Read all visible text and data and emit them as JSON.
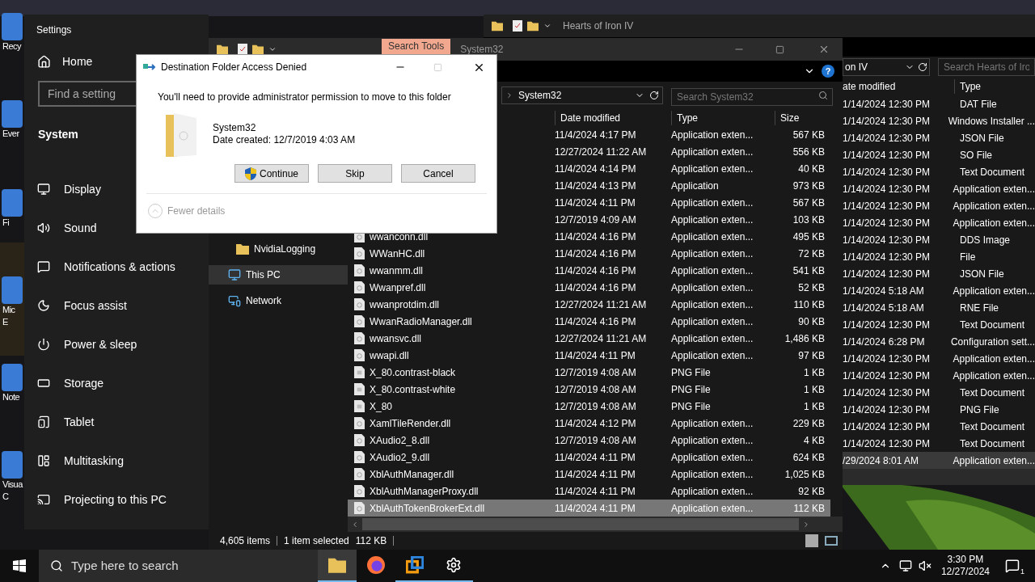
{
  "desktop_icons": [
    {
      "lines": [
        "Recy"
      ]
    },
    {
      "lines": [
        "Ever"
      ]
    },
    {
      "lines": [
        "Fi"
      ]
    },
    {
      "lines": [
        "Mic",
        "E"
      ]
    },
    {
      "lines": [
        "Note"
      ]
    },
    {
      "lines": [
        "Visua",
        "C"
      ]
    }
  ],
  "settings": {
    "title": "Settings",
    "home": "Home",
    "search_placeholder": "Find a setting",
    "section": "System",
    "items": [
      "Display",
      "Sound",
      "Notifications & actions",
      "Focus assist",
      "Power & sleep",
      "Storage",
      "Tablet",
      "Multitasking",
      "Projecting to this PC"
    ]
  },
  "hoi_window": {
    "title": "Hearts of Iron IV",
    "address": "on IV",
    "search_placeholder": "Search Hearts of Iro",
    "columns": [
      "ate modified",
      "Type"
    ],
    "rows": [
      {
        "date": "1/14/2024 12:30 PM",
        "type": "DAT File",
        "selected": false
      },
      {
        "date": "1/14/2024 12:30 PM",
        "type": "Windows Installer ...",
        "selected": false
      },
      {
        "date": "1/14/2024 12:30 PM",
        "type": "JSON File",
        "selected": false
      },
      {
        "date": "1/14/2024 12:30 PM",
        "type": "SO File",
        "selected": false
      },
      {
        "date": "1/14/2024 12:30 PM",
        "type": "Text Document",
        "selected": false
      },
      {
        "date": "1/14/2024 12:30 PM",
        "type": "Application exten...",
        "selected": false
      },
      {
        "date": "1/14/2024 12:30 PM",
        "type": "Application exten...",
        "selected": false
      },
      {
        "date": "1/14/2024 12:30 PM",
        "type": "Application exten...",
        "selected": false
      },
      {
        "date": "1/14/2024 12:30 PM",
        "type": "DDS Image",
        "selected": false
      },
      {
        "date": "1/14/2024 12:30 PM",
        "type": "File",
        "selected": false
      },
      {
        "date": "1/14/2024 12:30 PM",
        "type": "JSON File",
        "selected": false
      },
      {
        "date": "1/14/2024 5:18 AM",
        "type": "Application exten...",
        "selected": false
      },
      {
        "date": "1/14/2024 5:18 AM",
        "type": "RNE File",
        "selected": false
      },
      {
        "date": "1/14/2024 12:30 PM",
        "type": "Text Document",
        "selected": false
      },
      {
        "date": "1/14/2024 6:28 PM",
        "type": "Configuration sett...",
        "selected": false
      },
      {
        "date": "1/14/2024 12:30 PM",
        "type": "Application exten...",
        "selected": false
      },
      {
        "date": "1/14/2024 12:30 PM",
        "type": "Application exten...",
        "selected": false
      },
      {
        "date": "1/14/2024 12:30 PM",
        "type": "Text Document",
        "selected": false
      },
      {
        "date": "1/14/2024 12:30 PM",
        "type": "PNG File",
        "selected": false
      },
      {
        "date": "1/14/2024 12:30 PM",
        "type": "Text Document",
        "selected": false
      },
      {
        "date": "1/14/2024 12:30 PM",
        "type": "Text Document",
        "selected": false
      },
      {
        "date": "/29/2024 8:01 AM",
        "type": "Application exten...",
        "selected": true
      }
    ]
  },
  "explorer": {
    "ribbon_tab": "Search Tools",
    "title": "System32",
    "address": "System32",
    "search_placeholder": "Search System32",
    "help": "?",
    "nav": [
      {
        "label": "NvidiaLogging",
        "kind": "folder",
        "selected": false
      },
      {
        "label": "This PC",
        "kind": "pc",
        "selected": true
      },
      {
        "label": "Network",
        "kind": "network",
        "selected": false
      }
    ],
    "columns": [
      "Date modified",
      "Type",
      "Size"
    ],
    "rows": [
      {
        "date": "11/4/2024 4:17 PM",
        "type": "Application exten...",
        "size": "567 KB",
        "selected": false
      },
      {
        "date": "12/27/2024 11:22 AM",
        "type": "Application exten...",
        "size": "556 KB",
        "selected": false
      },
      {
        "date": "11/4/2024 4:14 PM",
        "type": "Application exten...",
        "size": "40 KB",
        "selected": false
      },
      {
        "date": "11/4/2024 4:13 PM",
        "type": "Application",
        "size": "973 KB",
        "selected": false
      },
      {
        "date": "11/4/2024 4:11 PM",
        "type": "Application exten...",
        "size": "567 KB",
        "selected": false
      },
      {
        "date": "12/7/2019 4:09 AM",
        "type": "Application exten...",
        "size": "103 KB",
        "selected": false
      },
      {
        "name": "wwanconn.dll",
        "kind": "dll",
        "date": "11/4/2024 4:16 PM",
        "type": "Application exten...",
        "size": "495 KB",
        "selected": false
      },
      {
        "name": "WWanHC.dll",
        "kind": "dll",
        "date": "11/4/2024 4:16 PM",
        "type": "Application exten...",
        "size": "72 KB",
        "selected": false
      },
      {
        "name": "wwanmm.dll",
        "kind": "dll",
        "date": "11/4/2024 4:16 PM",
        "type": "Application exten...",
        "size": "541 KB",
        "selected": false
      },
      {
        "name": "Wwanpref.dll",
        "kind": "dll",
        "date": "11/4/2024 4:16 PM",
        "type": "Application exten...",
        "size": "52 KB",
        "selected": false
      },
      {
        "name": "wwanprotdim.dll",
        "kind": "dll",
        "date": "12/27/2024 11:21 AM",
        "type": "Application exten...",
        "size": "110 KB",
        "selected": false
      },
      {
        "name": "WwanRadioManager.dll",
        "kind": "dll",
        "date": "11/4/2024 4:16 PM",
        "type": "Application exten...",
        "size": "90 KB",
        "selected": false
      },
      {
        "name": "wwansvc.dll",
        "kind": "dll",
        "date": "12/27/2024 11:21 AM",
        "type": "Application exten...",
        "size": "1,486 KB",
        "selected": false
      },
      {
        "name": "wwapi.dll",
        "kind": "dll",
        "date": "11/4/2024 4:11 PM",
        "type": "Application exten...",
        "size": "97 KB",
        "selected": false
      },
      {
        "name": "X_80.contrast-black",
        "kind": "png",
        "date": "12/7/2019 4:08 AM",
        "type": "PNG File",
        "size": "1 KB",
        "selected": false
      },
      {
        "name": "X_80.contrast-white",
        "kind": "png",
        "date": "12/7/2019 4:08 AM",
        "type": "PNG File",
        "size": "1 KB",
        "selected": false
      },
      {
        "name": "X_80",
        "kind": "png",
        "date": "12/7/2019 4:08 AM",
        "type": "PNG File",
        "size": "1 KB",
        "selected": false
      },
      {
        "name": "XamlTileRender.dll",
        "kind": "dll",
        "date": "11/4/2024 4:12 PM",
        "type": "Application exten...",
        "size": "229 KB",
        "selected": false
      },
      {
        "name": "XAudio2_8.dll",
        "kind": "dll",
        "date": "12/7/2019 4:08 AM",
        "type": "Application exten...",
        "size": "4 KB",
        "selected": false
      },
      {
        "name": "XAudio2_9.dll",
        "kind": "dll",
        "date": "11/4/2024 4:11 PM",
        "type": "Application exten...",
        "size": "624 KB",
        "selected": false
      },
      {
        "name": "XblAuthManager.dll",
        "kind": "dll",
        "date": "11/4/2024 4:11 PM",
        "type": "Application exten...",
        "size": "1,025 KB",
        "selected": false
      },
      {
        "name": "XblAuthManagerProxy.dll",
        "kind": "dll",
        "date": "11/4/2024 4:11 PM",
        "type": "Application exten...",
        "size": "92 KB",
        "selected": false
      },
      {
        "name": "XblAuthTokenBrokerExt.dll",
        "kind": "dll",
        "date": "11/4/2024 4:11 PM",
        "type": "Application exten...",
        "size": "112 KB",
        "selected": true
      }
    ],
    "status": {
      "items": "4,605 items",
      "selection": "1 item selected",
      "size": "112 KB"
    }
  },
  "dialog": {
    "title": "Destination Folder Access Denied",
    "message": "You'll need to provide administrator permission to move to this folder",
    "folder_name": "System32",
    "date_created": "Date created: 12/7/2019 4:03 AM",
    "buttons": [
      {
        "label": "Continue",
        "shield": true
      },
      {
        "label": "Skip",
        "shield": false
      },
      {
        "label": "Cancel",
        "shield": false
      }
    ],
    "details_toggle": "Fewer details"
  },
  "taskbar": {
    "search_placeholder": "Type here to search",
    "apps": [
      {
        "kind": "explorer",
        "active": true,
        "open": true
      },
      {
        "kind": "firefox",
        "active": false,
        "open": false
      },
      {
        "kind": "vm",
        "active": false,
        "open": true
      },
      {
        "kind": "settings",
        "active": false,
        "open": true
      }
    ],
    "time": "3:30 PM",
    "date": "12/27/2024",
    "notifications": "1"
  }
}
